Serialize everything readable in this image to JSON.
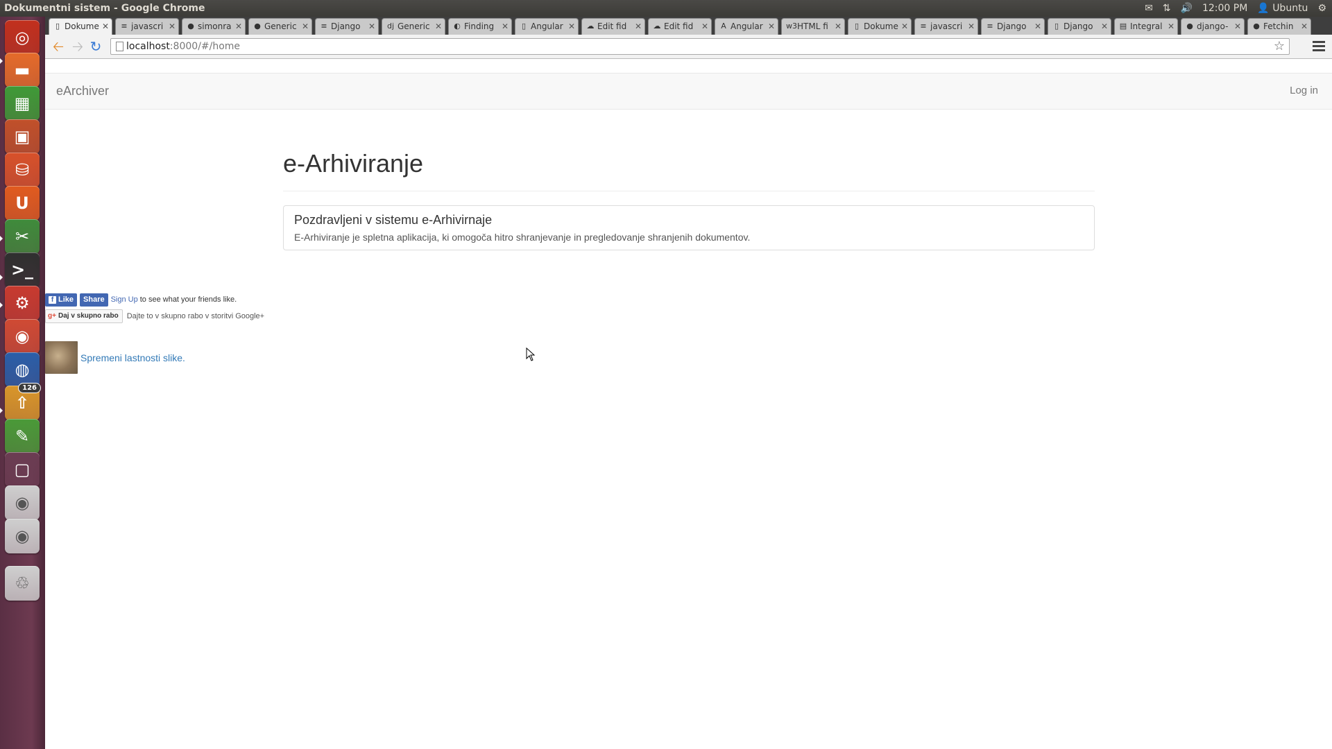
{
  "window": {
    "title": "Dokumentni sistem - Google Chrome",
    "clock": "12:00 PM",
    "user": "Ubuntu"
  },
  "launcher": {
    "items": [
      {
        "name": "ubuntu-dash",
        "color": "#c2301d"
      },
      {
        "name": "files",
        "color": "#e56b2a"
      },
      {
        "name": "libreoffice-calc",
        "color": "#3f9a37"
      },
      {
        "name": "libreoffice-impress",
        "color": "#c1502a"
      },
      {
        "name": "software-center",
        "color": "#d8512a"
      },
      {
        "name": "ubuntu-one",
        "color": "#e15b1f"
      },
      {
        "name": "system-tools",
        "color": "#3f8b3b"
      },
      {
        "name": "terminal",
        "color": "#2f2f2f"
      },
      {
        "name": "system-settings",
        "color": "#c83a2f"
      },
      {
        "name": "chrome",
        "color": "#d04a34"
      },
      {
        "name": "firefox",
        "color": "#2a5ea8"
      },
      {
        "name": "update-manager",
        "color": "#d9962a"
      },
      {
        "name": "gimp-app",
        "color": "#4a9a38"
      },
      {
        "name": "workspace-switcher",
        "color": "#6b3c52"
      },
      {
        "name": "dvd",
        "color": "#cfcfcf"
      },
      {
        "name": "disc",
        "color": "#cfcfcf"
      },
      {
        "name": "trash",
        "color": "#cfcfcf"
      }
    ],
    "update_badge": "126"
  },
  "tabs": [
    {
      "label": "Dokume",
      "active": true,
      "favicon": "page-icon"
    },
    {
      "label": "javascri",
      "favicon": "stackoverflow-icon"
    },
    {
      "label": "simonra",
      "favicon": "github-icon"
    },
    {
      "label": "Generic",
      "favicon": "pin-icon"
    },
    {
      "label": "Django",
      "favicon": "stackoverflow-icon"
    },
    {
      "label": "Generic",
      "favicon": "django-icon"
    },
    {
      "label": "Finding",
      "favicon": "globe-icon"
    },
    {
      "label": "Angular",
      "favicon": "page-icon"
    },
    {
      "label": "Edit fid",
      "favicon": "cloud-icon"
    },
    {
      "label": "Edit fid",
      "favicon": "cloud-icon"
    },
    {
      "label": "Angular",
      "favicon": "angular-icon"
    },
    {
      "label": "HTML fi",
      "favicon": "w3-icon"
    },
    {
      "label": "Dokume",
      "favicon": "page-icon"
    },
    {
      "label": "javascri",
      "favicon": "stackoverflow-icon"
    },
    {
      "label": "Django",
      "favicon": "stackoverflow-icon"
    },
    {
      "label": "Django",
      "favicon": "page-icon"
    },
    {
      "label": "Integral",
      "favicon": "doc-icon"
    },
    {
      "label": "django-",
      "favicon": "github-icon"
    },
    {
      "label": "Fetchin",
      "favicon": "github-icon"
    }
  ],
  "toolbar": {
    "url_host": "localhost",
    "url_rest": ":8000/#/home"
  },
  "page": {
    "brand": "eArchiver",
    "login": "Log in",
    "title": "e-Arhiviranje",
    "panel_heading": "Pozdravljeni v sistemu e-Arhivirnaje",
    "panel_body": "E-Arhiviranje je spletna aplikacija, ki omogoča hitro shranjevanje in pregledovanje shranjenih dokumentov.",
    "fb_like": "Like",
    "fb_share": "Share",
    "fb_signup": "Sign Up",
    "fb_text": "to see what your friends like.",
    "gplus_button": "Daj v skupno rabo",
    "gplus_text": "Dajte to v skupno rabo v storitvi Google+",
    "image_link": "Spremeni lastnosti slike."
  }
}
